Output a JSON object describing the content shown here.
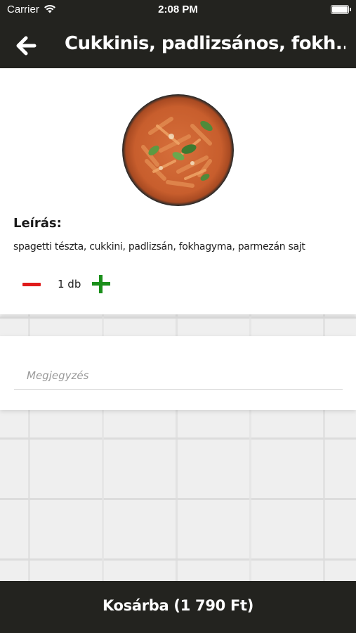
{
  "status_bar": {
    "carrier": "Carrier",
    "time": "2:08 PM"
  },
  "nav": {
    "title": "Cukkinis, padlizsános, fokh..."
  },
  "product": {
    "description_heading": "Leírás:",
    "description": "spagetti tészta, cukkini, padlizsán, fokhagyma, parmezán sajt",
    "quantity": "1 db"
  },
  "note": {
    "placeholder": "Megjegyzés"
  },
  "cart": {
    "label": "Kosárba (1 790 Ft)"
  },
  "colors": {
    "bar_background": "#23231f",
    "minus": "#e01b1b",
    "plus": "#1a8f1a"
  },
  "icons": {
    "back": "arrow-left",
    "wifi": "wifi",
    "battery": "battery-full"
  }
}
